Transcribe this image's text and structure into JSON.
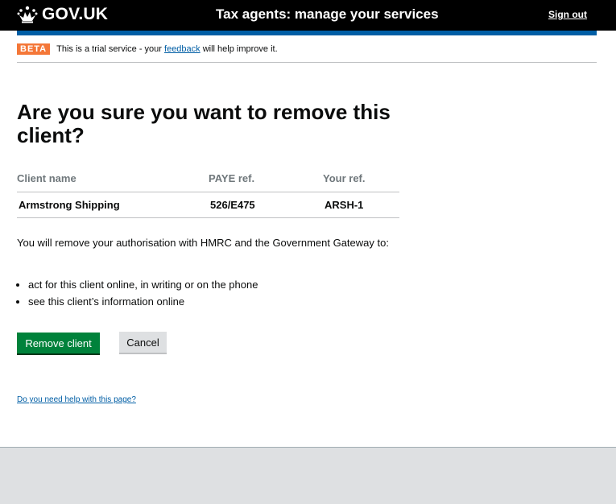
{
  "header": {
    "logo_text": "GOV.UK",
    "service_name": "Tax agents: manage your services",
    "signout_label": "Sign out"
  },
  "beta_banner": {
    "tag": "BETA",
    "text_before": "This is a trial service - your ",
    "link_label": "feedback",
    "text_after": " will help improve it."
  },
  "main": {
    "heading": "Are you sure you want to remove this client?",
    "table": {
      "headers": [
        "Client name",
        "PAYE ref.",
        "Your ref."
      ],
      "rows": [
        [
          "Armstrong Shipping",
          "526/E475",
          "ARSH-1"
        ]
      ]
    },
    "intro": "You will remove your authorisation with HMRC and the Government Gateway to:",
    "bullets": [
      "act for this client online, in writing or on the phone",
      "see this client’s information online"
    ],
    "remove_label": "Remove client",
    "cancel_label": "Cancel",
    "help_link": "Do you need help with this page?"
  },
  "colors": {
    "header_bg": "#000000",
    "blue_bar": "#005ea5",
    "beta_tag": "#f47738",
    "primary_button": "#00823b",
    "link": "#005ea5"
  }
}
